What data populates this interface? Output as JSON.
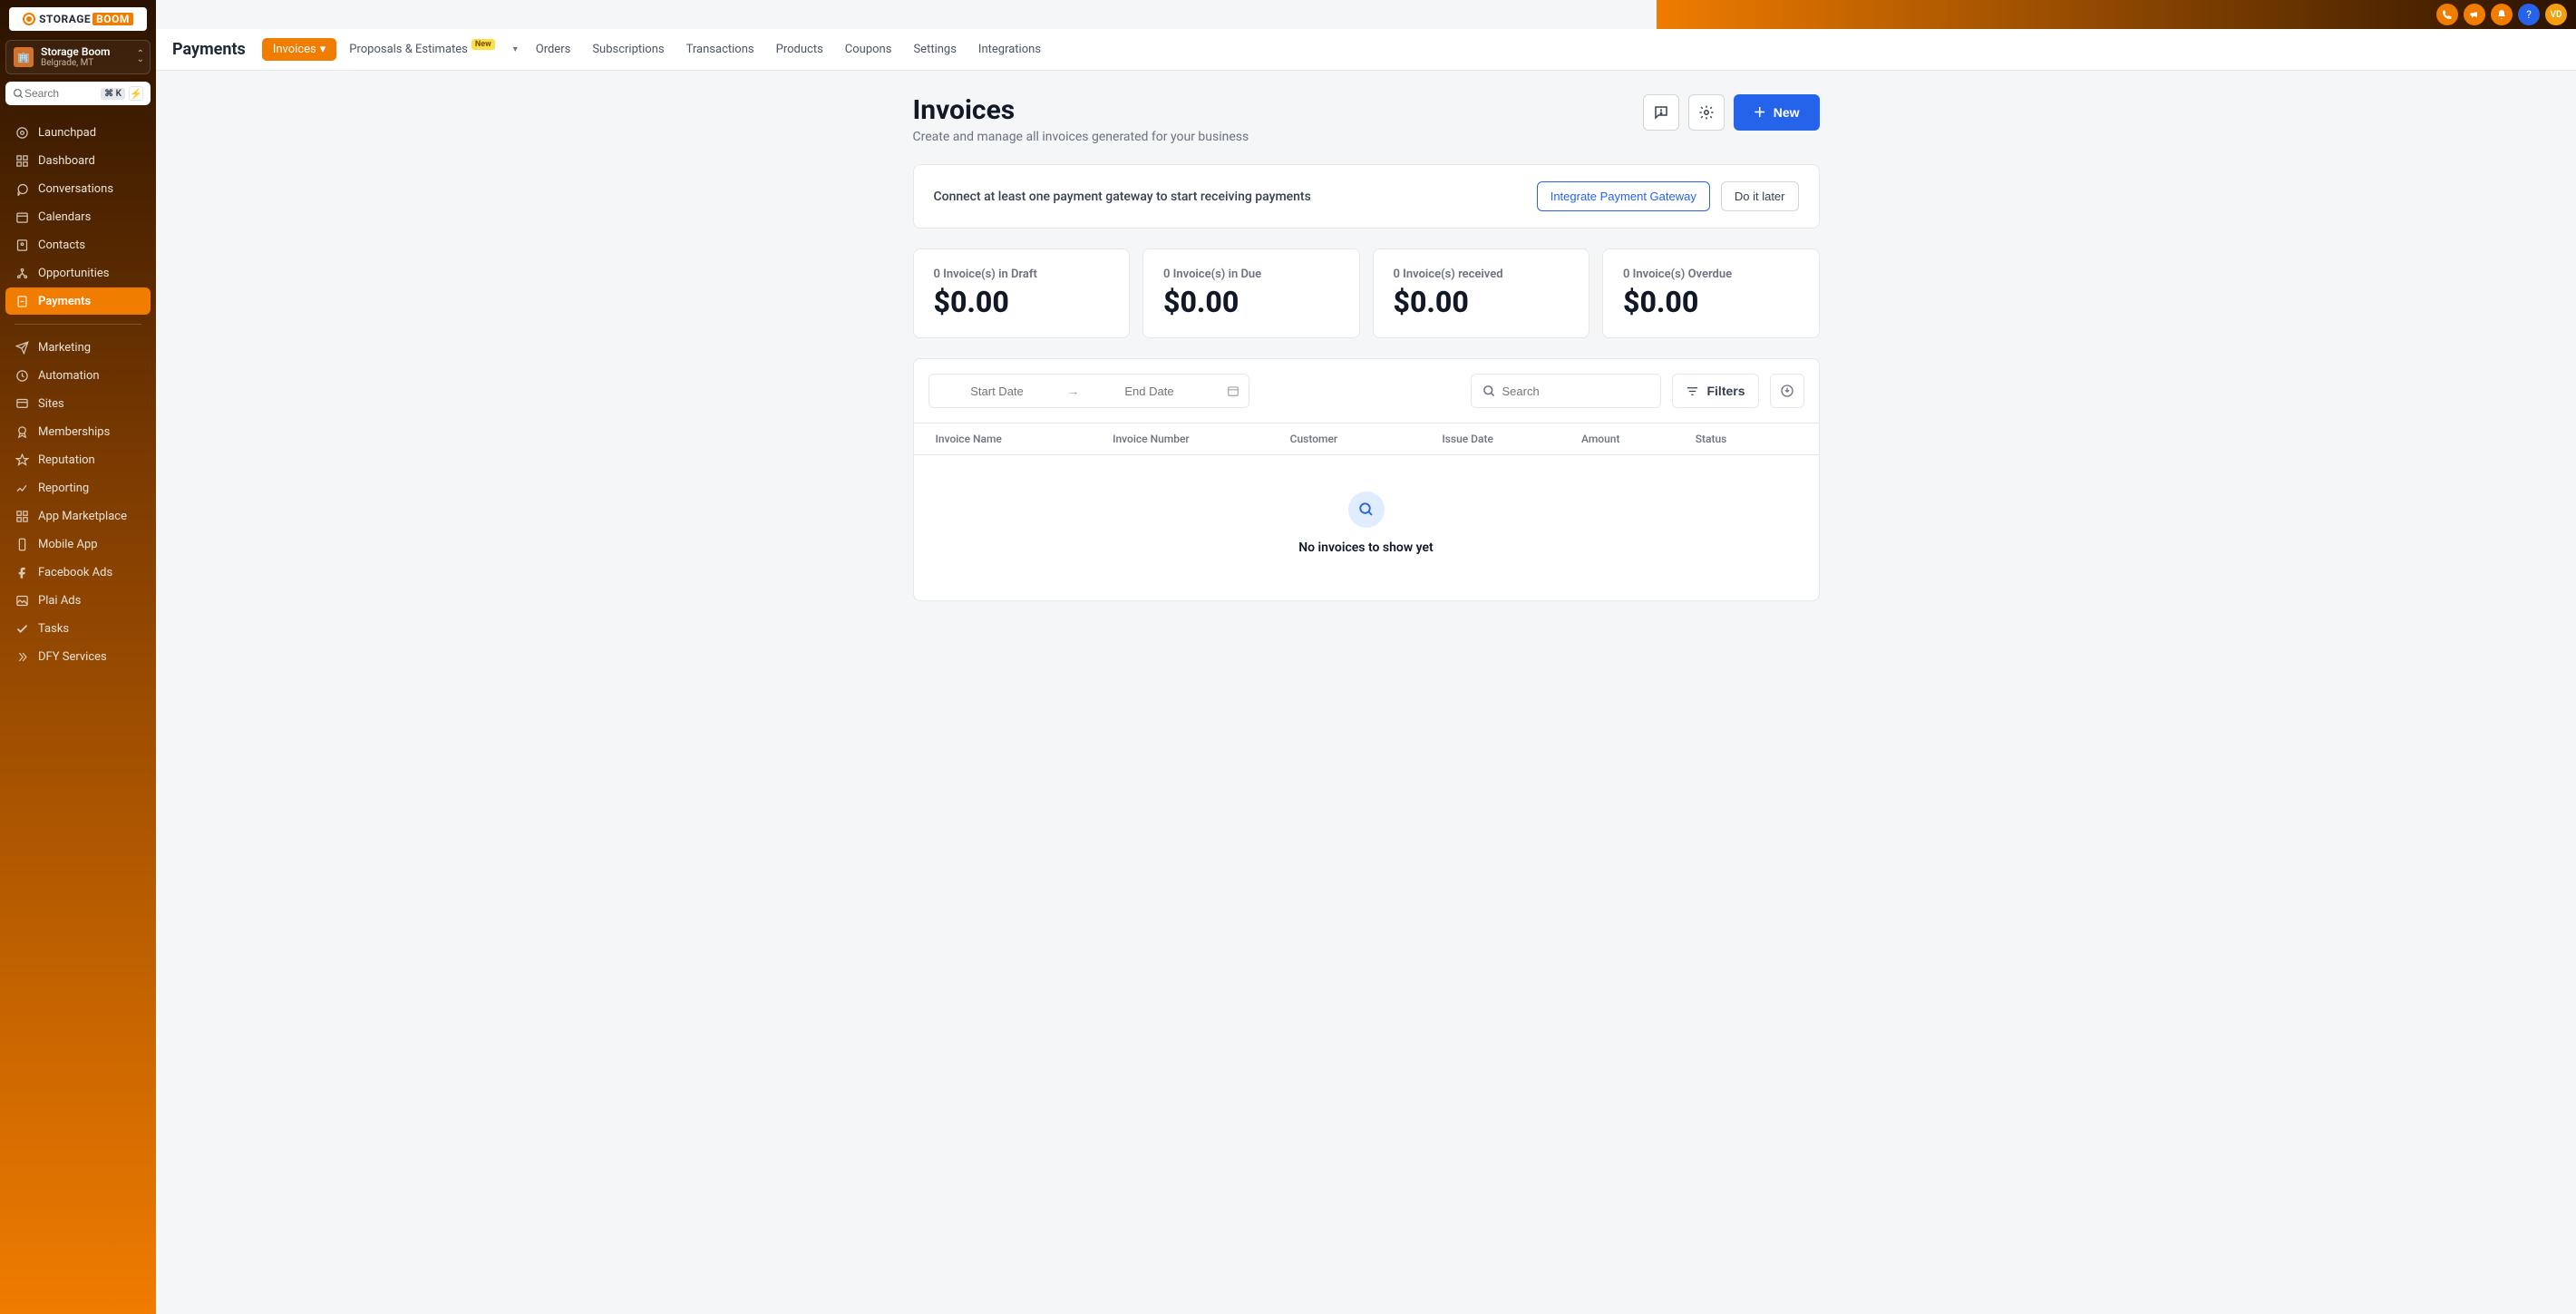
{
  "brand": {
    "name_a": "STORAGE",
    "name_b": "BOOM"
  },
  "account": {
    "name": "Storage Boom",
    "location": "Belgrade, MT",
    "avatar_letter": "🏢"
  },
  "search": {
    "placeholder": "Search",
    "kbd": "⌘ K"
  },
  "sidebar": {
    "items": [
      {
        "label": "Launchpad"
      },
      {
        "label": "Dashboard"
      },
      {
        "label": "Conversations"
      },
      {
        "label": "Calendars"
      },
      {
        "label": "Contacts"
      },
      {
        "label": "Opportunities"
      },
      {
        "label": "Payments"
      },
      {
        "label": "Marketing"
      },
      {
        "label": "Automation"
      },
      {
        "label": "Sites"
      },
      {
        "label": "Memberships"
      },
      {
        "label": "Reputation"
      },
      {
        "label": "Reporting"
      },
      {
        "label": "App Marketplace"
      },
      {
        "label": "Mobile App"
      },
      {
        "label": "Facebook Ads"
      },
      {
        "label": "Plai Ads"
      },
      {
        "label": "Tasks"
      },
      {
        "label": "DFY Services"
      }
    ]
  },
  "topbar": {
    "avatar_initials": "VD"
  },
  "subnav": {
    "section": "Payments",
    "active": "Invoices",
    "tabs": [
      {
        "label": "Proposals & Estimates",
        "badge": "New"
      },
      {
        "label": "Orders"
      },
      {
        "label": "Subscriptions"
      },
      {
        "label": "Transactions"
      },
      {
        "label": "Products"
      },
      {
        "label": "Coupons"
      },
      {
        "label": "Settings"
      },
      {
        "label": "Integrations"
      }
    ]
  },
  "page": {
    "title": "Invoices",
    "subtitle": "Create and manage all invoices generated for your business",
    "new_label": "New"
  },
  "alert": {
    "message": "Connect at least one payment gateway to start receiving payments",
    "primary": "Integrate Payment Gateway",
    "secondary": "Do it later"
  },
  "stats": [
    {
      "label": "0 Invoice(s) in Draft",
      "value": "$0.00"
    },
    {
      "label": "0 Invoice(s) in Due",
      "value": "$0.00"
    },
    {
      "label": "0 Invoice(s) received",
      "value": "$0.00"
    },
    {
      "label": "0 Invoice(s) Overdue",
      "value": "$0.00"
    }
  ],
  "table": {
    "start_placeholder": "Start Date",
    "end_placeholder": "End Date",
    "search_placeholder": "Search",
    "filters_label": "Filters",
    "columns": [
      "Invoice Name",
      "Invoice Number",
      "Customer",
      "Issue Date",
      "Amount",
      "Status"
    ],
    "empty": "No invoices to show yet"
  }
}
